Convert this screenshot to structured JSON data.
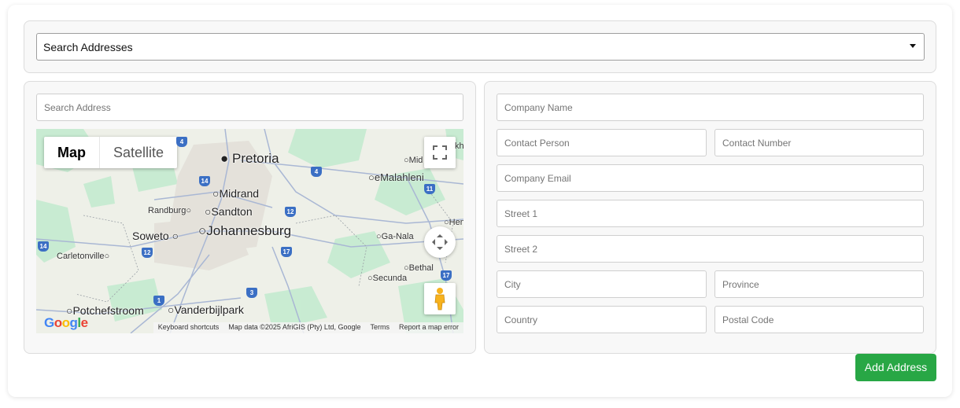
{
  "address_search": {
    "selected": "Search Addresses"
  },
  "map_panel": {
    "search_placeholder": "Search Address",
    "map_type": {
      "map_label": "Map",
      "satellite_label": "Satellite"
    },
    "places": {
      "pretoria": "Pretoria",
      "emalahleni": "eMalahleni",
      "midrand": "Midrand",
      "randburg": "Randburg",
      "sandton": "Sandton",
      "soweto": "Soweto",
      "johannesburg": "Johannesburg",
      "carletonville": "Carletonville",
      "ganala": "Ga-Nala",
      "bethal": "Bethal",
      "secunda": "Secunda",
      "potchefstroom": "Potchefstroom",
      "vanderbijlpark": "Vanderbijlpark",
      "mid_partial": "Mid",
      "hen_partial": "Hen",
      "kh_partial": "kh"
    },
    "route_shields": [
      "4",
      "4",
      "14",
      "11",
      "12",
      "14",
      "12",
      "17",
      "17",
      "1",
      "3"
    ],
    "attribution": {
      "shortcuts": "Keyboard shortcuts",
      "map_data": "Map data ©2025 AfriGIS (Pty) Ltd, Google",
      "terms": "Terms",
      "report": "Report a map error"
    },
    "logo_text": "Google"
  },
  "form": {
    "company_name": "Company Name",
    "contact_person": "Contact Person",
    "contact_number": "Contact Number",
    "company_email": "Company Email",
    "street1": "Street 1",
    "street2": "Street 2",
    "city": "City",
    "province": "Province",
    "country": "Country",
    "postal_code": "Postal Code"
  },
  "actions": {
    "add_address": "Add Address"
  },
  "colors": {
    "primary_button": "#28a745",
    "map_water": "#aadaff",
    "map_park": "#c2ecd0"
  }
}
